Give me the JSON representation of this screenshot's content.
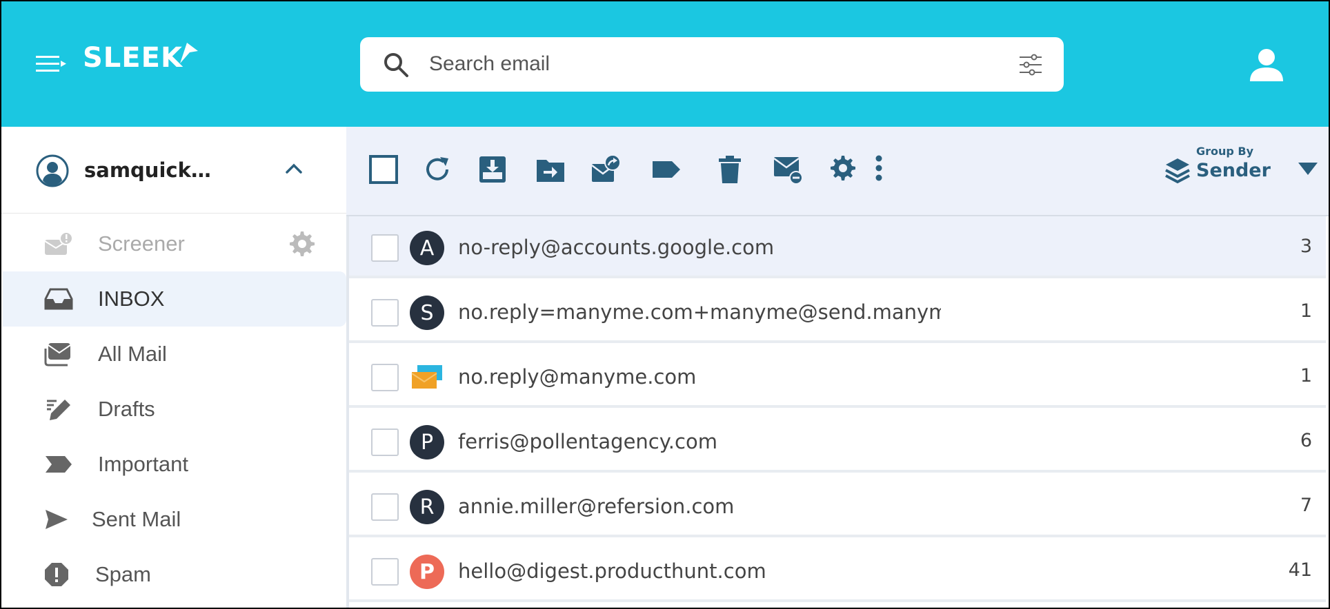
{
  "header": {
    "logo_text": "SLEEK",
    "search_placeholder": "Search email",
    "colors": {
      "header_bg": "#1bc7e1",
      "accent": "#2a5f7e"
    }
  },
  "sidebar": {
    "account_name": "samquick…",
    "items": [
      {
        "label": "Screener",
        "icon": "screener-icon"
      },
      {
        "label": "INBOX",
        "icon": "inbox-icon",
        "active": true
      },
      {
        "label": "All Mail",
        "icon": "all-mail-icon"
      },
      {
        "label": "Drafts",
        "icon": "drafts-icon"
      },
      {
        "label": "Important",
        "icon": "important-icon"
      },
      {
        "label": "Sent Mail",
        "icon": "sent-icon"
      },
      {
        "label": "Spam",
        "icon": "spam-icon"
      }
    ]
  },
  "toolbar": {
    "group_by_caption": "Group By",
    "group_by_value": "Sender"
  },
  "mail_list": [
    {
      "avatar": "A",
      "sender": "no-reply@accounts.google.com",
      "count": "3"
    },
    {
      "avatar": "S",
      "sender": "no.reply=manyme.com+manyme@send.manym…",
      "count": "1"
    },
    {
      "avatar": "",
      "sender": "no.reply@manyme.com",
      "count": "1"
    },
    {
      "avatar": "P",
      "sender": "ferris@pollentagency.com",
      "count": "6"
    },
    {
      "avatar": "R",
      "sender": "annie.miller@refersion.com",
      "count": "7"
    },
    {
      "avatar": "P",
      "sender": "hello@digest.producthunt.com",
      "count": "41"
    }
  ]
}
